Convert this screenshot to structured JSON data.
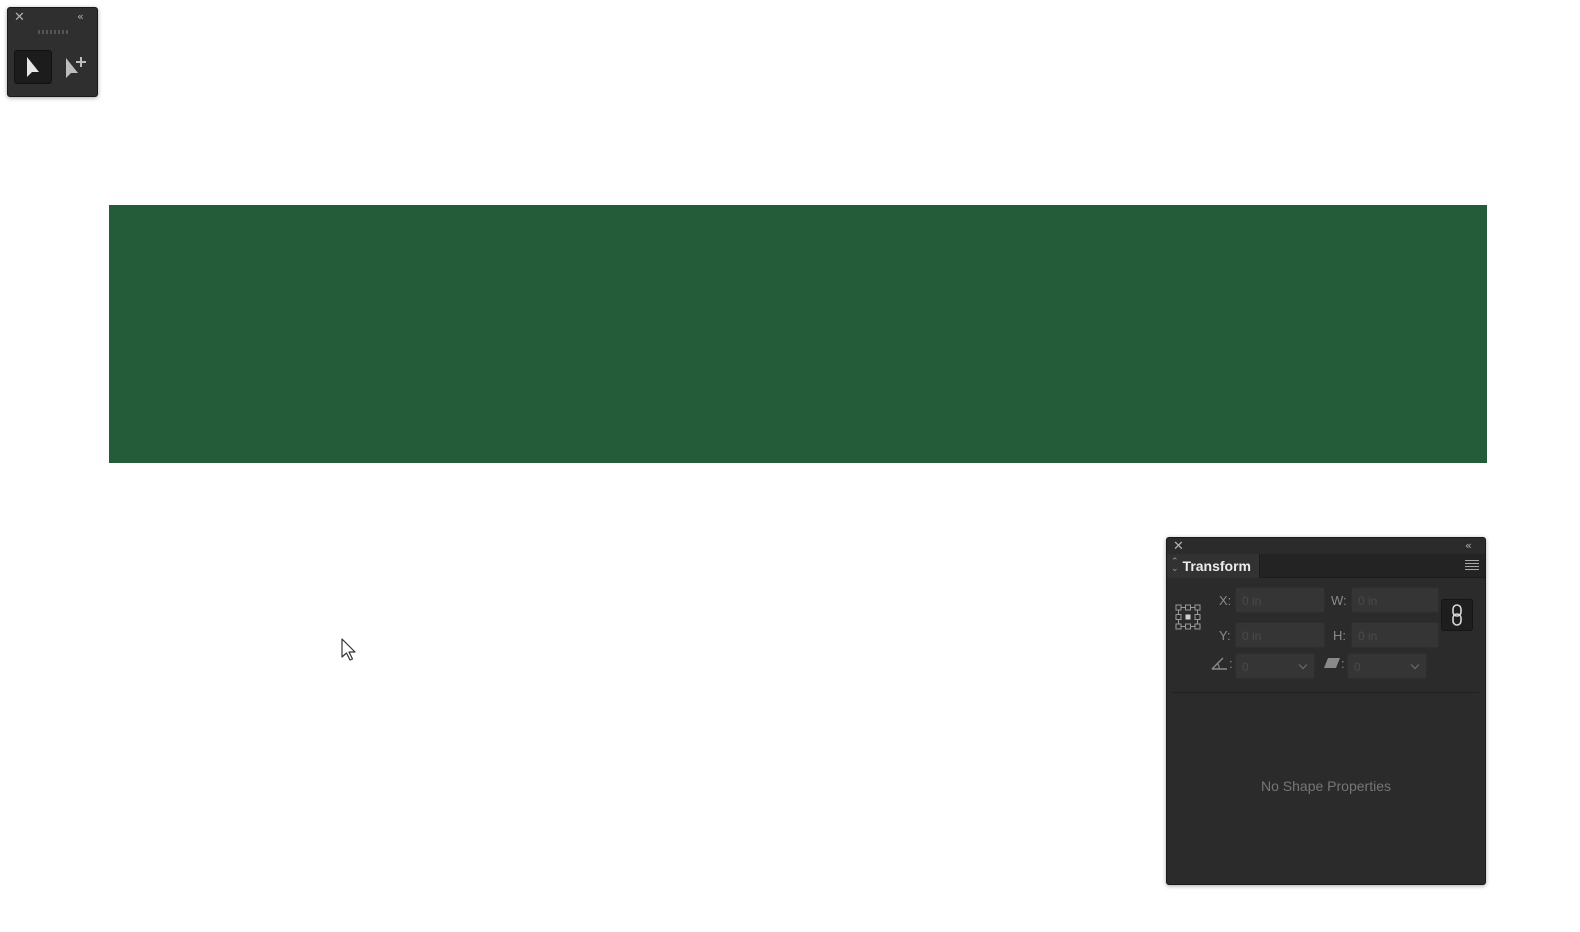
{
  "tool_panel": {
    "close_glyph": "✕",
    "collapse_glyph": "‹‹",
    "tools": [
      {
        "name": "selection-tool",
        "icon": "arrow-icon",
        "active": true
      },
      {
        "name": "direct-selection-plus-tool",
        "icon": "arrow-plus-icon",
        "active": false
      }
    ]
  },
  "canvas": {
    "rectangle_color": "#245c3a"
  },
  "transform_panel": {
    "close_glyph": "✕",
    "collapse_glyph": "‹‹",
    "tab_label": "Transform",
    "fields": {
      "x_label": "X:",
      "x_placeholder": "0 in",
      "w_label": "W:",
      "w_placeholder": "0 in",
      "y_label": "Y:",
      "y_placeholder": "0 in",
      "h_label": "H:",
      "h_placeholder": "0 in",
      "angle_label": ":",
      "angle_value": "0",
      "shear_label": ":",
      "shear_value": "0"
    },
    "empty_message": "No Shape Properties"
  }
}
